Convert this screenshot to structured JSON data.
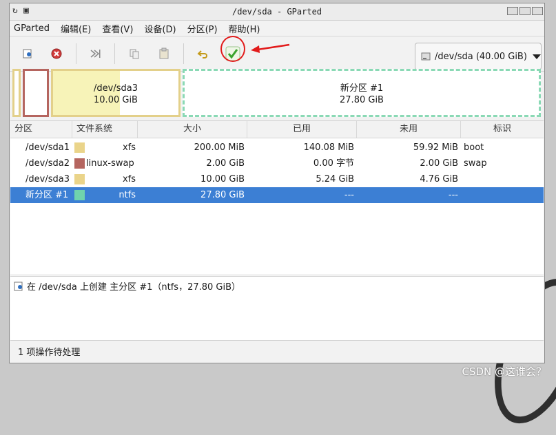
{
  "window": {
    "title": "/dev/sda - GParted"
  },
  "menu": [
    "GParted",
    "编辑(E)",
    "查看(V)",
    "设备(D)",
    "分区(P)",
    "帮助(H)"
  ],
  "toolbar": {
    "icons": [
      "new-partition-icon",
      "delete-icon",
      "resize-move-icon",
      "copy-icon",
      "paste-icon",
      "undo-icon",
      "apply-icon"
    ],
    "device_label": "/dev/sda (40.00 GiB)"
  },
  "annotation": {
    "color": "#e21b1b"
  },
  "partition_map": [
    {
      "name": "",
      "size": "",
      "color": "#b5655f"
    },
    {
      "name": "/dev/sda3",
      "size": "10.00 GiB",
      "color": "#e6d88a"
    },
    {
      "name": "新分区 #1",
      "size": "27.80 GiB",
      "color": "#8ad9b5"
    }
  ],
  "table": {
    "headers": [
      "分区",
      "文件系统",
      "大小",
      "已用",
      "未用",
      "标识"
    ],
    "rows": [
      {
        "partition": "/dev/sda1",
        "fs": "xfs",
        "fs_color": "#ead48a",
        "size": "200.00 MiB",
        "used": "140.08 MiB",
        "unused": "59.92 MiB",
        "flags": "boot",
        "selected": false
      },
      {
        "partition": "/dev/sda2",
        "fs": "linux-swap",
        "fs_color": "#b5655f",
        "size": "2.00 GiB",
        "used": "0.00 字节",
        "unused": "2.00 GiB",
        "flags": "swap",
        "selected": false
      },
      {
        "partition": "/dev/sda3",
        "fs": "xfs",
        "fs_color": "#ead48a",
        "size": "10.00 GiB",
        "used": "5.24 GiB",
        "unused": "4.76 GiB",
        "flags": "",
        "selected": false
      },
      {
        "partition": "新分区 #1",
        "fs": "ntfs",
        "fs_color": "#70d3ad",
        "size": "27.80 GiB",
        "used": "---",
        "unused": "---",
        "flags": "",
        "selected": true
      }
    ]
  },
  "operations": [
    "在 /dev/sda 上创建 主分区 #1（ntfs，27.80 GiB）"
  ],
  "status": "1 项操作待处理",
  "watermark": "CSDN @这谁会？"
}
